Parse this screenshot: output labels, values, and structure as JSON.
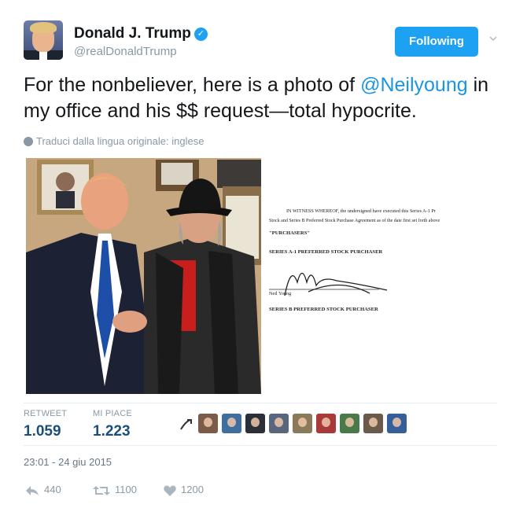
{
  "header": {
    "display_name": "Donald J. Trump",
    "handle": "@realDonaldTrump",
    "follow_label": "Following"
  },
  "tweet": {
    "text_part1": "For the nonbeliever, here is a photo of ",
    "mention": "@Neilyoung",
    "text_part2": " in my office and his $$ request—total hypocrite.",
    "translate_label": "Traduci dalla lingua originale: inglese"
  },
  "document": {
    "line1": "IN WITNESS WHEREOF, the undersigned have executed this Series A-1 Pr",
    "line2": "Stock and Series B Preferred Stock Purchase Agreement as of the date first set forth above",
    "purchasers": "\"PURCHASERS\"",
    "series_a": "SERIES A-1 PREFERRED STOCK PURCHASER",
    "signer": "Neil Young",
    "series_b": "SERIES B PREFERRED STOCK PURCHASER"
  },
  "stats": {
    "retweet_label": "RETWEET",
    "retweet_count": "1.059",
    "likes_label": "MI PIACE",
    "likes_count": "1.223"
  },
  "liker_colors": [
    "#7a5c48",
    "#3f6f9e",
    "#2b3038",
    "#58677d",
    "#8a7a5a",
    "#a83a3a",
    "#4a7a4a",
    "#6a5a4a",
    "#355f9a"
  ],
  "timestamp": "23:01 - 24 giu 2015",
  "actions": {
    "reply_count": "440",
    "retweet_count": "1100",
    "like_count": "1200"
  },
  "colors": {
    "accent": "#1da1f2",
    "mention": "#1b95e0",
    "muted": "#8899a6"
  }
}
